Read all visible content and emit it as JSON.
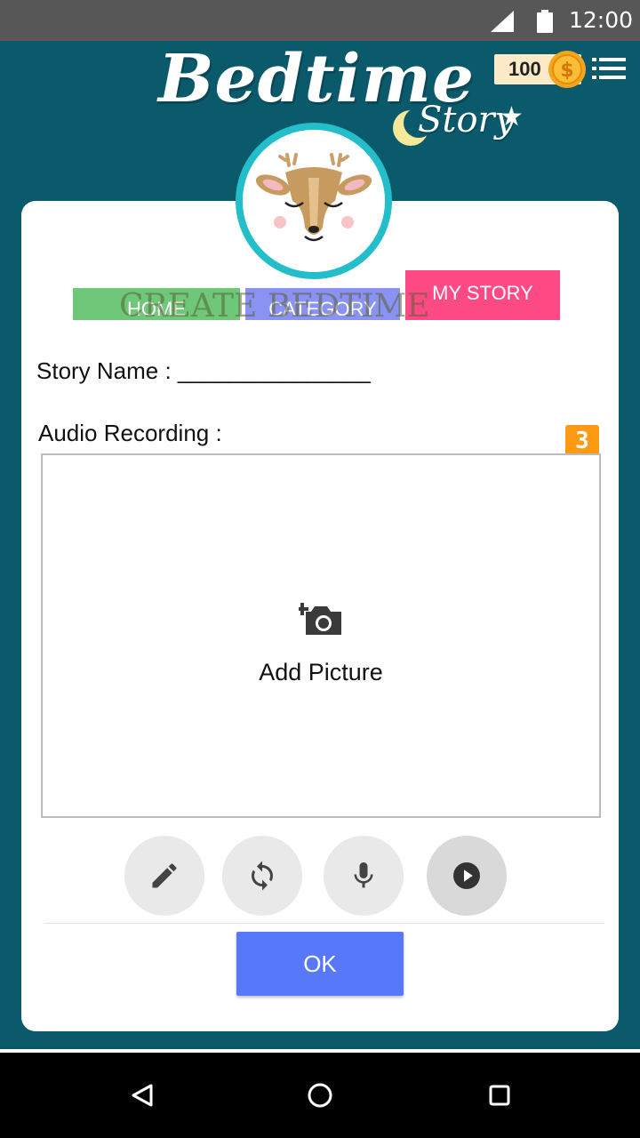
{
  "status_bar": {
    "time": "12:00"
  },
  "header": {
    "logo_title": "Bedtime",
    "logo_subtitle": "Story",
    "coins": "100"
  },
  "tabs": {
    "home": "HOME",
    "category": "CATEGORY",
    "my_story": "MY STORY",
    "overlay_text": "CREATE BEDTIME"
  },
  "form": {
    "story_name_label": "Story Name : _______________",
    "audio_label": "Audio Recording :",
    "badge": "3",
    "add_picture": "Add Picture"
  },
  "actions": {
    "ok": "OK"
  },
  "colors": {
    "background": "#0b5a6b",
    "home_tab": "#6fc77a",
    "category_tab": "#8a93f3",
    "my_story_tab": "#fd4a85",
    "ok_button": "#5878fa",
    "badge": "#fd9a12",
    "avatar_ring": "#23bec9"
  },
  "icons": [
    "signal-icon",
    "battery-icon",
    "coin-icon",
    "menu-icon",
    "deer-avatar",
    "add-photo-icon",
    "pencil-icon",
    "sync-icon",
    "mic-icon",
    "play-icon",
    "back-icon",
    "home-circle-icon",
    "recent-apps-icon"
  ]
}
